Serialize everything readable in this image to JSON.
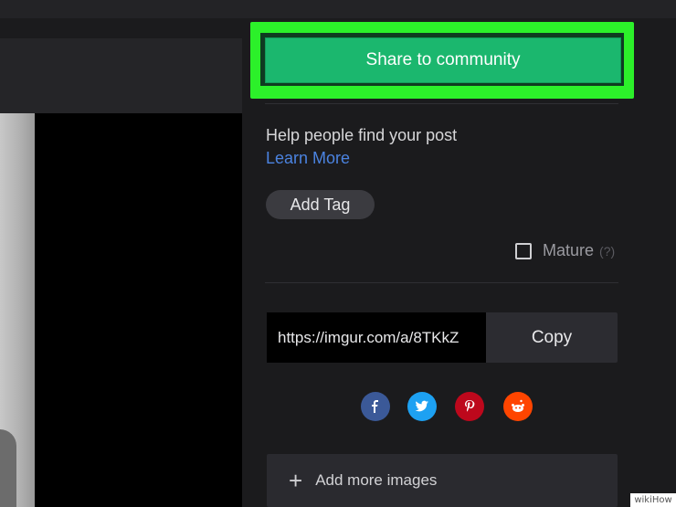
{
  "share": {
    "label": "Share to community"
  },
  "help": {
    "text": "Help people find your post",
    "learn_more": "Learn More"
  },
  "tag": {
    "label": "Add Tag"
  },
  "mature": {
    "label": "Mature",
    "help": "(?)"
  },
  "link": {
    "url": "https://imgur.com/a/8TKkZ",
    "copy_label": "Copy"
  },
  "social": {
    "facebook": {
      "icon": "facebook-icon",
      "color": "#3b5998"
    },
    "twitter": {
      "icon": "twitter-icon",
      "color": "#1da1f2"
    },
    "pinterest": {
      "icon": "pinterest-icon",
      "color": "#bd081c"
    },
    "reddit": {
      "icon": "reddit-icon",
      "color": "#ff4500"
    }
  },
  "add_more": {
    "label": "Add more images"
  },
  "watermark": {
    "text": "wikiHow"
  },
  "colors": {
    "highlight": "#2cf02a",
    "share_button": "#1bb76e",
    "link": "#4b83e0"
  }
}
